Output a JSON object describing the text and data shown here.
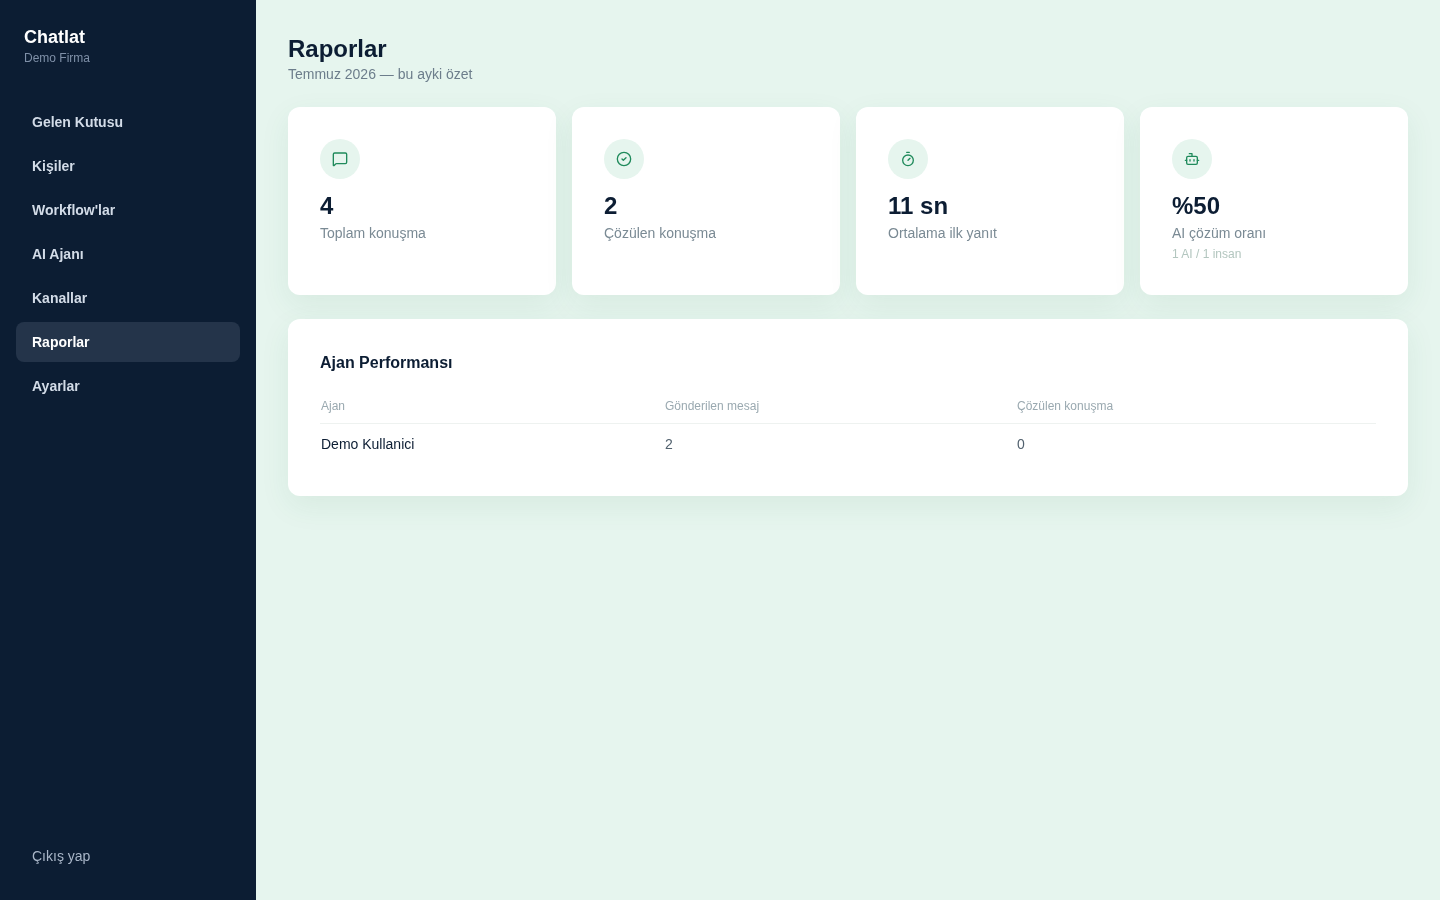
{
  "sidebar": {
    "brand": "Chatlat",
    "company": "Demo Firma",
    "items": [
      {
        "label": "Gelen Kutusu",
        "selected": false
      },
      {
        "label": "Kişiler",
        "selected": false
      },
      {
        "label": "Workflow'lar",
        "selected": false
      },
      {
        "label": "AI Ajanı",
        "selected": false
      },
      {
        "label": "Kanallar",
        "selected": false
      },
      {
        "label": "Raporlar",
        "selected": true
      },
      {
        "label": "Ayarlar",
        "selected": false
      }
    ],
    "logout": "Çıkış yap"
  },
  "header": {
    "title": "Raporlar",
    "subtitle": "Temmuz 2026 — bu ayki özet"
  },
  "stats": [
    {
      "value": "4",
      "label": "Toplam konuşma"
    },
    {
      "value": "2",
      "label": "Çözülen konuşma"
    },
    {
      "value": "11 sn",
      "label": "Ortalama ilk yanıt"
    },
    {
      "value": "%50",
      "label": "AI çözüm oranı",
      "note": "1 AI / 1 insan"
    }
  ],
  "agent_table": {
    "title": "Ajan Performansı",
    "columns": [
      "Ajan",
      "Gönderilen mesaj",
      "Çözülen konuşma"
    ],
    "rows": [
      [
        "Demo Kullanici",
        "2",
        "0"
      ]
    ]
  }
}
